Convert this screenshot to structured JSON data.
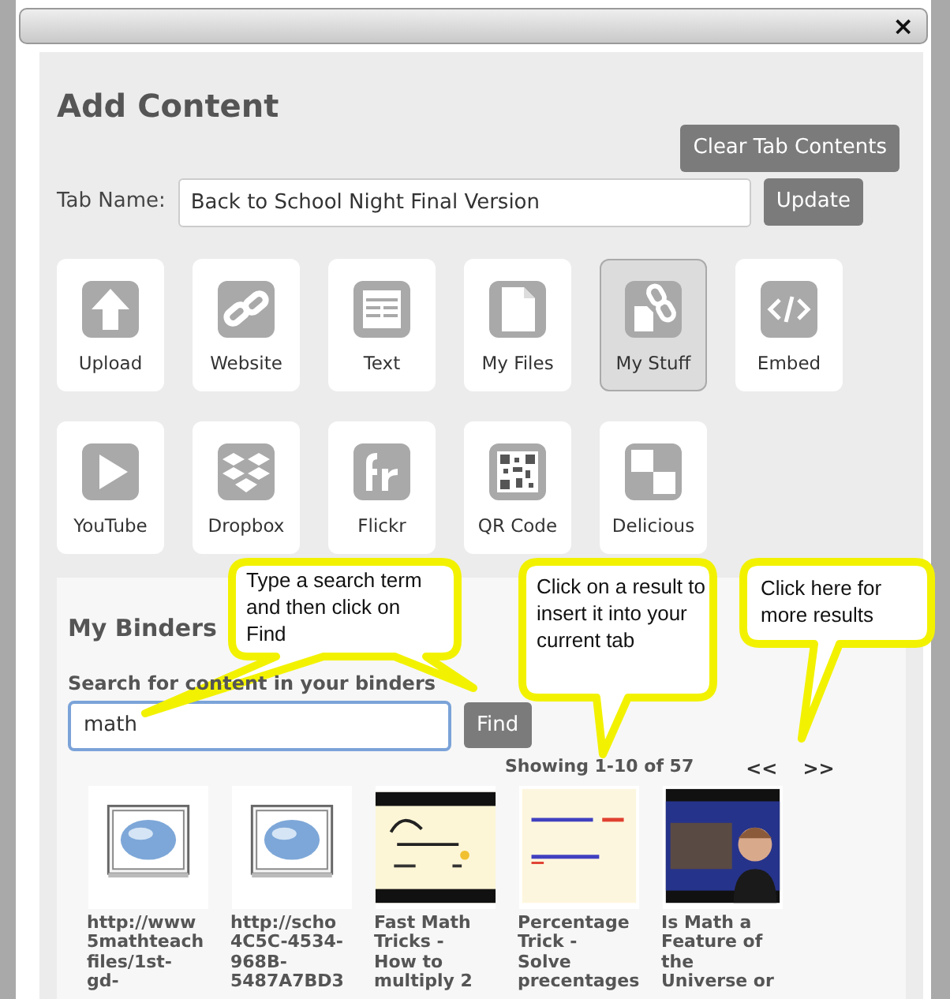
{
  "dialog": {
    "close": "×",
    "title": "Add Content",
    "clear_button": "Clear Tab Contents",
    "tab_name_label": "Tab Name:",
    "tab_name_value": "Back to School Night Final Version",
    "update_button": "Update"
  },
  "tiles": [
    {
      "label": "Upload",
      "selected": false
    },
    {
      "label": "Website",
      "selected": false
    },
    {
      "label": "Text",
      "selected": false
    },
    {
      "label": "My Files",
      "selected": false
    },
    {
      "label": "My Stuff",
      "selected": true
    },
    {
      "label": "Embed",
      "selected": false
    },
    {
      "label": "YouTube",
      "selected": false
    },
    {
      "label": "Dropbox",
      "selected": false
    },
    {
      "label": "Flickr",
      "selected": false
    },
    {
      "label": "QR Code",
      "selected": false
    },
    {
      "label": "Delicious",
      "selected": false
    }
  ],
  "binders": {
    "title": "My Binders",
    "search_label": "Search for content in your binders",
    "search_value": "math",
    "find_button": "Find",
    "showing": "Showing 1-10 of 57",
    "prev": "<<",
    "next": ">>",
    "results": [
      {
        "kind": "link",
        "lines": [
          "http://www",
          "5mathteach",
          "files/1st-",
          "gd-"
        ]
      },
      {
        "kind": "link",
        "lines": [
          "http://scho",
          "4C5C-4534-",
          "968B-",
          "5487A7BD3"
        ]
      },
      {
        "kind": "picture",
        "lines": [
          "Fast Math",
          "Tricks -",
          "How to",
          "multiply 2"
        ]
      },
      {
        "kind": "picture",
        "lines": [
          "Percentage",
          "Trick -",
          "Solve",
          "precentages"
        ]
      },
      {
        "kind": "picture",
        "lines": [
          "Is Math a",
          "Feature of",
          "the",
          "Universe or"
        ]
      }
    ]
  },
  "callouts": [
    "Type a search term and then click on Find",
    "Click on a result to insert it into your current tab",
    "Click here for more results"
  ]
}
